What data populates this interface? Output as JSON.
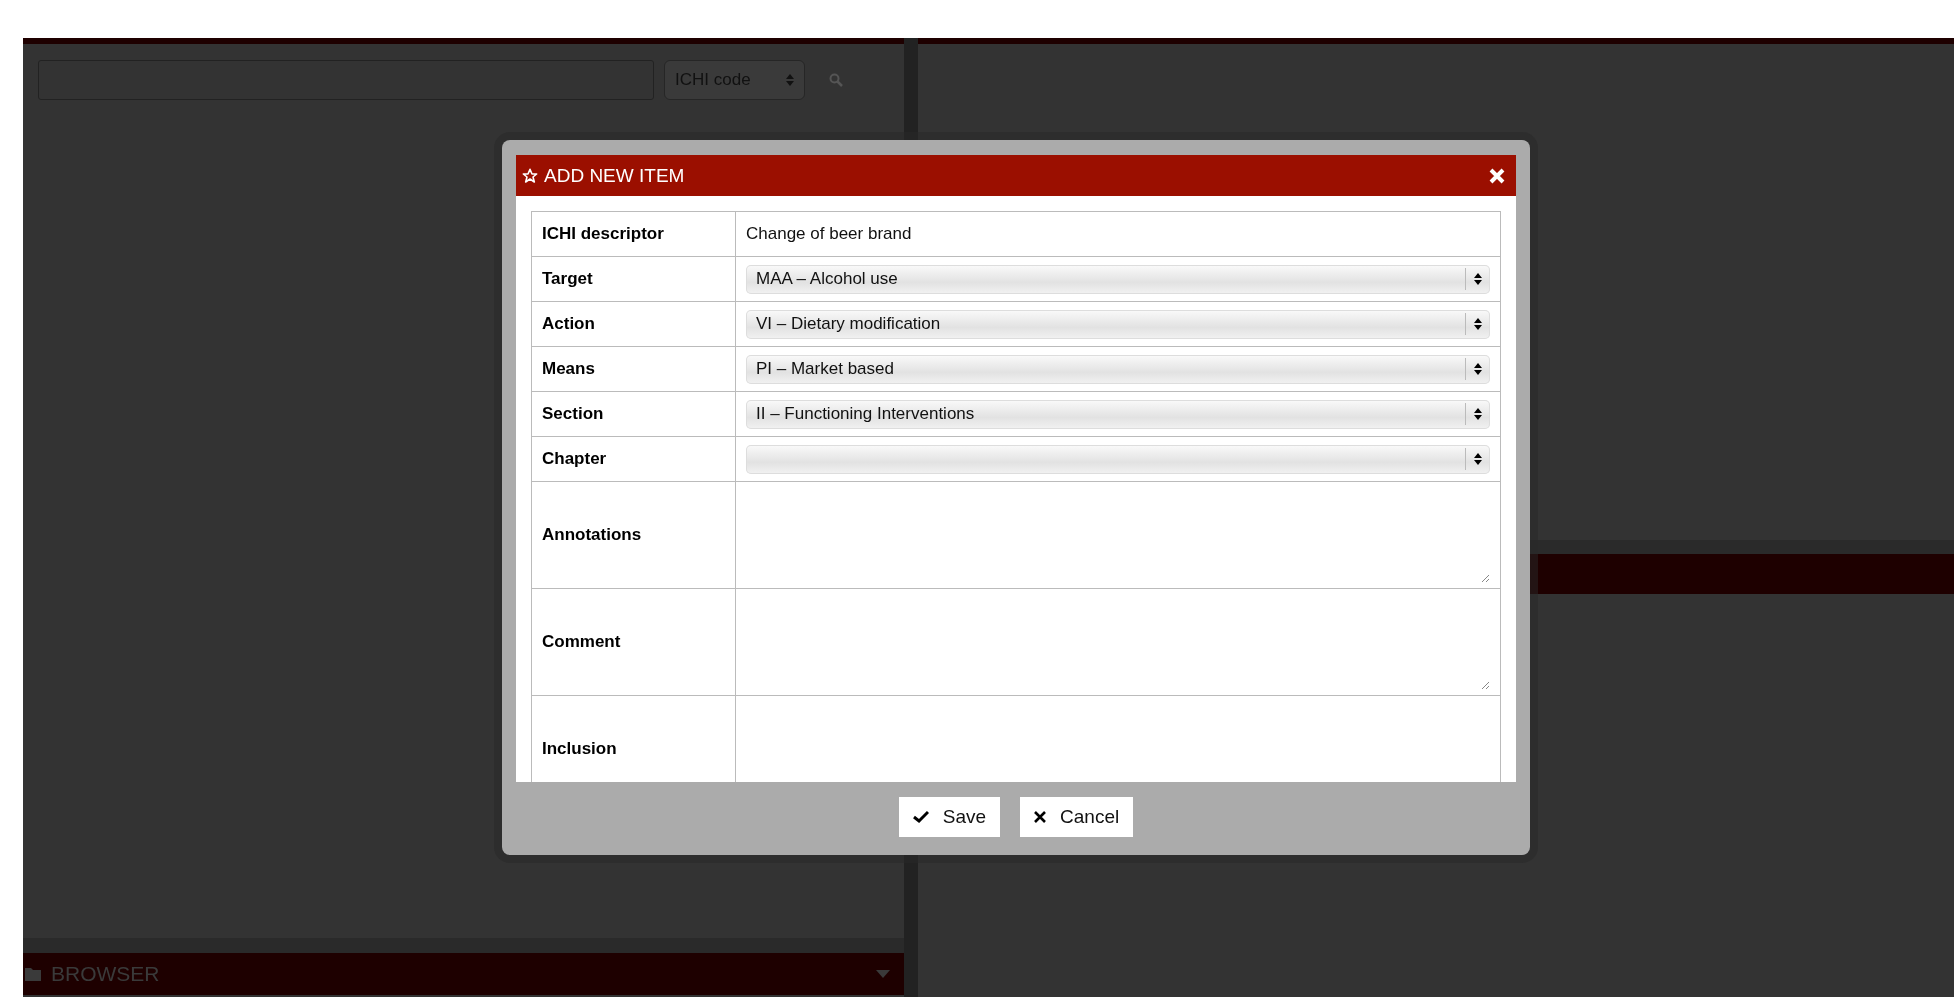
{
  "search_panel": {
    "search_by": "ICHI code"
  },
  "browser_bar": {
    "title": "BROWSER"
  },
  "dialog": {
    "title": "ADD NEW ITEM",
    "fields": [
      {
        "label": "ICHI descriptor",
        "kind": "text",
        "value": "Change of beer brand"
      },
      {
        "label": "Target",
        "kind": "select",
        "value": "MAA – Alcohol use"
      },
      {
        "label": "Action",
        "kind": "select",
        "value": "VI – Dietary modification"
      },
      {
        "label": "Means",
        "kind": "select",
        "value": "PI – Market based"
      },
      {
        "label": "Section",
        "kind": "select",
        "value": "II – Functioning Interventions"
      },
      {
        "label": "Chapter",
        "kind": "select"
      },
      {
        "label": "Annotations",
        "kind": "textarea"
      },
      {
        "label": "Comment",
        "kind": "textarea"
      },
      {
        "label": "Inclusion",
        "kind": "textarea"
      }
    ],
    "buttons": [
      {
        "label": "Save",
        "kind": "save"
      },
      {
        "label": "Cancel",
        "kind": "cancel"
      }
    ]
  }
}
